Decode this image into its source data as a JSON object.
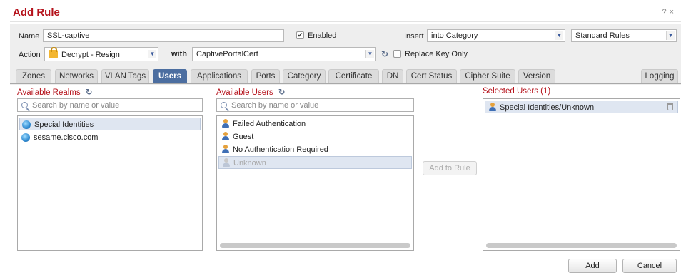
{
  "dialog": {
    "title": "Add Rule",
    "help": "?",
    "close": "×"
  },
  "form": {
    "name_label": "Name",
    "name_value": "SSL-captive",
    "enabled_label": "Enabled",
    "enabled_checked": true,
    "insert_label": "Insert",
    "insert_value": "into Category",
    "category_value": "Standard Rules",
    "action_label": "Action",
    "action_value": "Decrypt - Resign",
    "with_label": "with",
    "cert_value": "CaptivePortalCert",
    "replace_key_label": "Replace Key Only",
    "replace_key_checked": false
  },
  "tabs": [
    "Zones",
    "Networks",
    "VLAN Tags",
    "Users",
    "Applications",
    "Ports",
    "Category",
    "Certificate",
    "DN",
    "Cert Status",
    "Cipher Suite",
    "Version",
    "Logging"
  ],
  "active_tab": "Users",
  "realms": {
    "title": "Available Realms",
    "search_placeholder": "Search by name or value",
    "items": [
      "Special Identities",
      "sesame.cisco.com"
    ]
  },
  "users": {
    "title": "Available Users",
    "search_placeholder": "Search by name or value",
    "items": [
      "Failed Authentication",
      "Guest",
      "No Authentication Required",
      "Unknown"
    ]
  },
  "add_to_rule_label": "Add to Rule",
  "selected": {
    "title": "Selected Users (1)",
    "items": [
      "Special Identities/Unknown"
    ]
  },
  "footer": {
    "add_label": "Add",
    "cancel_label": "Cancel"
  },
  "colors": {
    "accent_red": "#b5121b",
    "active_tab": "#4c6ea0"
  }
}
